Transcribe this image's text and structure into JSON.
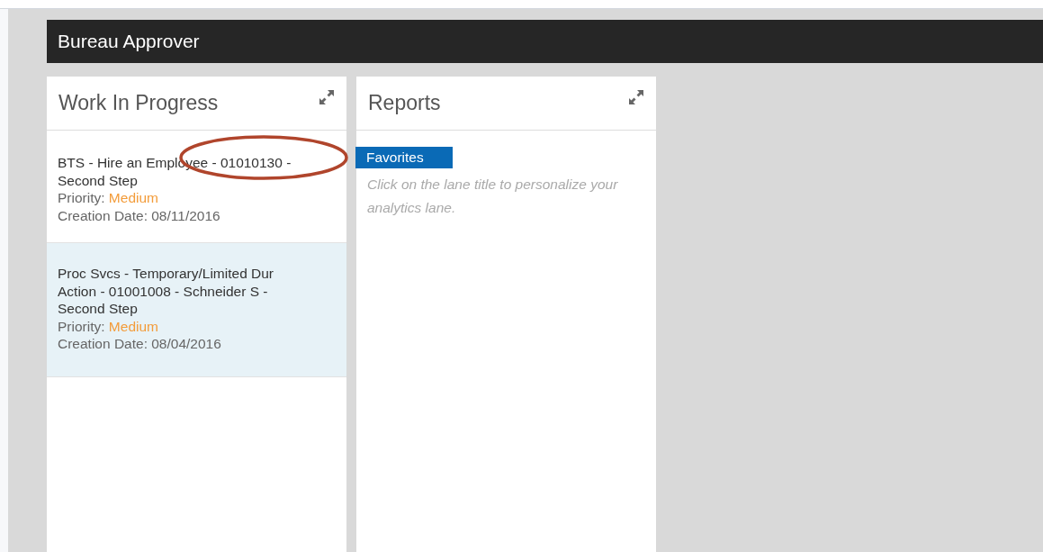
{
  "header": {
    "title": "Bureau Approver"
  },
  "lanes": [
    {
      "kind": "tasks",
      "title": "Work In Progress",
      "items": [
        {
          "title": "BTS - Hire an Employee - 01010130 - Second Step",
          "priority_label": "Priority:",
          "priority": "Medium",
          "date": "Creation Date: 08/11/2016",
          "selected": false,
          "circled": true
        },
        {
          "title": "Proc Svcs - Temporary/Limited Dur Action - 01001008 - Schneider S - Second Step",
          "priority_label": "Priority:",
          "priority": "Medium",
          "date": "Creation Date: 08/04/2016",
          "selected": true,
          "circled": false
        }
      ]
    },
    {
      "kind": "reports",
      "title": "Reports",
      "tab": "Favorites",
      "hint": "Click on the lane title to personalize your analytics lane."
    }
  ]
}
